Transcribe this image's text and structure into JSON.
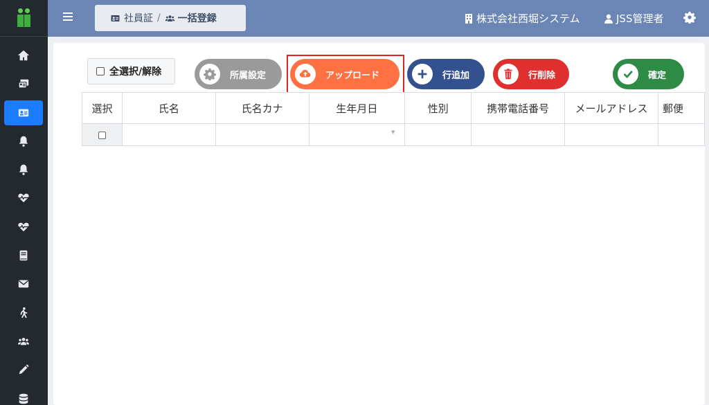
{
  "topbar": {
    "breadcrumb_parent": "社員証",
    "breadcrumb_sep": "/",
    "breadcrumb_current": "一括登録",
    "company": "株式会社西堀システム",
    "user": "JSS管理者"
  },
  "toolbar": {
    "select_all": "全選択/解除",
    "dept_setting": "所属設定",
    "upload": "アップロード",
    "add_row": "行追加",
    "delete_row": "行削除",
    "confirm": "確定"
  },
  "table": {
    "columns": [
      "選択",
      "氏名",
      "氏名カナ",
      "生年月日",
      "性別",
      "携帯電話番号",
      "メールアドレス",
      "郵便"
    ]
  },
  "sidebar": {
    "items": [
      "home-icon",
      "id-cards-icon",
      "id-card-icon",
      "bell-icon",
      "bell-icon",
      "heartbeat-icon",
      "heartbeat-icon",
      "book-icon",
      "envelope-icon",
      "walking-icon",
      "users-icon",
      "pencil-icon",
      "database-icon"
    ]
  },
  "colors": {
    "topbar": "#6b86b5",
    "sidebar": "#23292f",
    "active_nav": "#1c7cff",
    "upload": "#ff7043",
    "add": "#34518f",
    "delete": "#e02f2f",
    "confirm": "#2e8b45",
    "dept": "#9a9a9a"
  }
}
